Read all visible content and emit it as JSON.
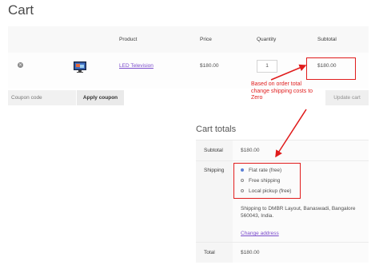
{
  "page": {
    "title": "Cart"
  },
  "cart_table": {
    "headers": {
      "product": "Product",
      "price": "Price",
      "quantity": "Quantity",
      "subtotal": "Subtotal"
    },
    "rows": [
      {
        "product": "LED Television",
        "price": "$180.00",
        "quantity": "1",
        "subtotal": "$180.00",
        "remove_icon": "remove-circle-icon",
        "thumbnail": "tv-thumbnail"
      }
    ]
  },
  "coupon": {
    "placeholder": "Coupon code",
    "apply_label": "Apply coupon",
    "update_label": "Update cart"
  },
  "annotation": {
    "text": "Based on order total change shipping costs to Zero",
    "color": "#e01c1c"
  },
  "totals": {
    "title": "Cart totals",
    "subtotal_label": "Subtotal",
    "subtotal_value": "$180.00",
    "shipping_label": "Shipping",
    "shipping_options": [
      {
        "label": "Flat rate (free)",
        "selected": true
      },
      {
        "label": "Free shipping",
        "selected": false
      },
      {
        "label": "Local pickup (free)",
        "selected": false
      }
    ],
    "shipping_destination": "Shipping to DMBR Layout, Banaswadi, Bangalore 560043, India.",
    "change_address": "Change address",
    "total_label": "Total",
    "total_value": "$180.00"
  },
  "colors": {
    "link": "#7b4ccc",
    "annotation": "#e01c1c",
    "radio_selected": "#5b7fd6"
  }
}
